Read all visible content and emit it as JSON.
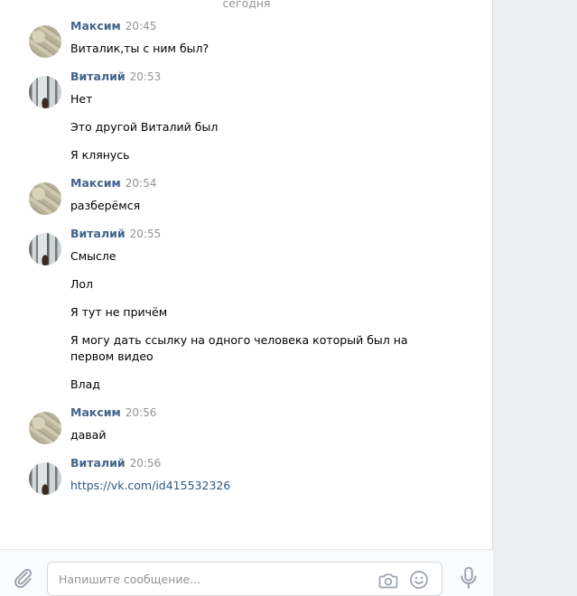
{
  "date_divider": "сегодня",
  "messages": [
    {
      "author": "Максим",
      "time": "20:45",
      "avatar": "money-photo-avatar",
      "lines": [
        "Виталик,ты с ним был?"
      ]
    },
    {
      "author": "Виталий",
      "time": "20:53",
      "avatar": "forest-photo-avatar",
      "lines": [
        "Нет",
        "Это другой Виталий был",
        "Я клянусь"
      ]
    },
    {
      "author": "Максим",
      "time": "20:54",
      "avatar": "money-photo-avatar",
      "lines": [
        "разберёмся"
      ]
    },
    {
      "author": "Виталий",
      "time": "20:55",
      "avatar": "forest-photo-avatar",
      "lines": [
        "Смысле",
        "Лол",
        "Я тут не причём",
        "Я могу дать ссылку на одного человека который был на",
        "первом видео",
        "Влад"
      ]
    },
    {
      "author": "Максим",
      "time": "20:56",
      "avatar": "money-photo-avatar",
      "lines": [
        "давай"
      ]
    },
    {
      "author": "Виталий",
      "time": "20:56",
      "avatar": "forest-photo-avatar",
      "link": "https://vk.com/id415532326"
    }
  ],
  "composer": {
    "placeholder": "Напишите сообщение...",
    "attach_icon": "paperclip-icon",
    "camera_icon": "camera-icon",
    "emoji_icon": "smile-icon",
    "voice_icon": "microphone-icon"
  },
  "colors": {
    "author": "#42648b",
    "time": "#939393",
    "link": "#2a5885",
    "icon": "#99a2ad"
  }
}
